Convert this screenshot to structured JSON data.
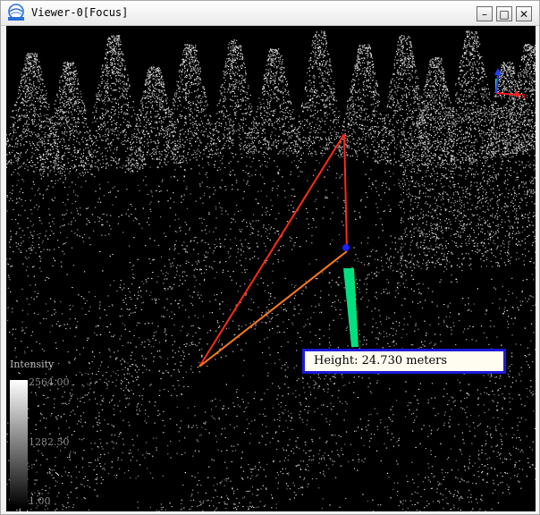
{
  "window": {
    "title": "Viewer-0[Focus]",
    "controls": {
      "minimize": "–",
      "maximize": "□",
      "close": "✕"
    },
    "logo_icon": "lidar360-logo-icon"
  },
  "measurement": {
    "label": "Height: 24.730 meters",
    "line_color": "#ff2a1a",
    "vertical_color": "#00e080",
    "anchor_color": "#2020ff"
  },
  "legend": {
    "title": "Intensity",
    "max": "2564.00",
    "mid": "1282.50",
    "min": "1.00"
  },
  "axes": {
    "x_label": "x",
    "colors": {
      "x": "#ff2020",
      "y": "#20ff20",
      "z": "#2040ff"
    }
  }
}
